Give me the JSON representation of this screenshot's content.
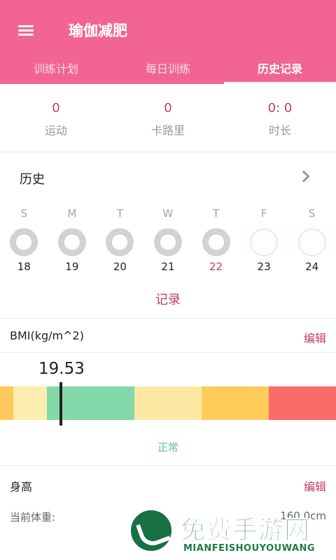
{
  "appbar": {
    "title": "瑜伽减肥",
    "menu_icon": "hamburger-menu-icon"
  },
  "tabs": [
    {
      "label": "训练计划",
      "active": false
    },
    {
      "label": "每日训练",
      "active": false
    },
    {
      "label": "历史记录",
      "active": true
    }
  ],
  "stats": [
    {
      "value": "0",
      "label": "运动"
    },
    {
      "value": "0",
      "label": "卡路里"
    },
    {
      "value": "0: 0",
      "label": "时长"
    }
  ],
  "history": {
    "title": "历史",
    "weekdays": [
      "S",
      "M",
      "T",
      "W",
      "T",
      "F",
      "S"
    ],
    "dates": [
      "18",
      "19",
      "20",
      "21",
      "22",
      "23",
      "24"
    ],
    "today_index": 4,
    "record_link": "记录"
  },
  "bmi": {
    "title": "BMI(kg/m^2)",
    "edit_label": "编辑",
    "value": "19.53",
    "value_number": 19.53,
    "status": "正常",
    "colors": [
      "#ffc95b",
      "#fdeeaf",
      "#84d9aa",
      "#fde9a4",
      "#ffcc5c",
      "#fb6b69"
    ]
  },
  "height": {
    "title": "身高",
    "edit_label": "编辑",
    "weight_label": "当前体重:",
    "weight_value": "160.0cm"
  },
  "watermark": {
    "title": "免费手游网",
    "subtitle": "MIANFEISHOUYOUWANG"
  }
}
